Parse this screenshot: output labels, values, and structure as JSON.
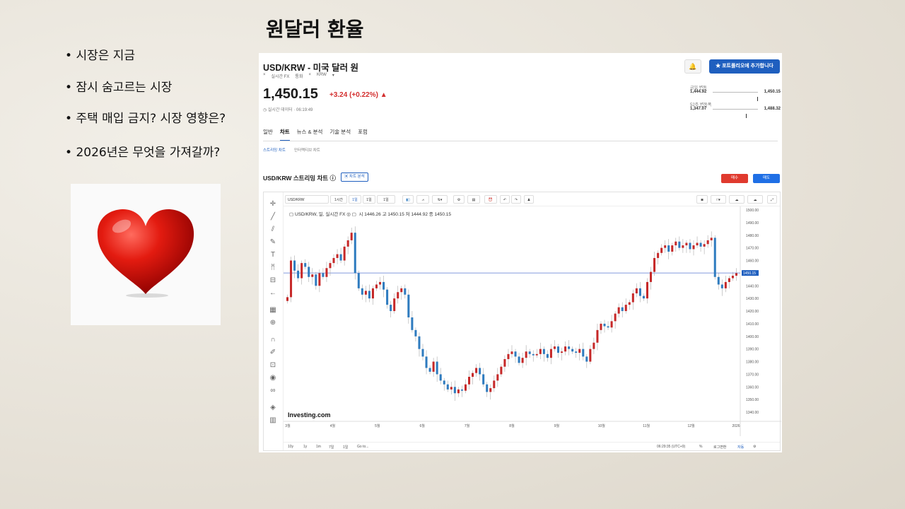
{
  "slide": {
    "title": "원달러 환율",
    "bullets": [
      "시장은 지금",
      "잠시 숨고르는 시장",
      "주택 매입 금지? 시장 영향은?",
      "2026년은 무엇을 가져갈까?"
    ]
  },
  "quote": {
    "pair": "USD/KRW - 미국 달러 원",
    "tags": [
      "×",
      "실시간 FX",
      "통화",
      "×",
      "KRW",
      "▾"
    ],
    "price": "1,450.15",
    "change": "+3.24 (+0.22%) ▲",
    "time": "◷ 실시간 데이터 · 06:19:49",
    "bell": "🔔",
    "portfolio_btn": "★  포트폴리오에 추가합니다",
    "day_range": {
      "label": "금일 변동",
      "low": "1,444.92",
      "high": "1,450.15",
      "pos": 0.98
    },
    "week52_range": {
      "label": "52주 변동폭",
      "low": "1,347.07",
      "high": "1,488.32",
      "pos": 0.73
    }
  },
  "tabs": [
    "일반",
    "차트",
    "뉴스 & 분석",
    "기술 분석",
    "포럼"
  ],
  "active_tab": "차트",
  "subtabs": [
    "스트리밍 차트",
    "인터랙티브 차트"
  ],
  "chart_header": {
    "title": "USD/KRW 스트리밍 차트  ⓘ",
    "analysis_btn": "▣ 차트 분석",
    "sell": "매수",
    "buy": "매도"
  },
  "toolbar": {
    "symbol": "USD/KRW",
    "interval": "1시간",
    "items": [
      "1일",
      "1일",
      "1일"
    ]
  },
  "legend": {
    "text": "▢ USD/KRW, 일, 실시간 FX  ◎ ▢",
    "ohlc": "시 1446.26  고 1450.15  저 1444.92  종 1450.15"
  },
  "bottom": {
    "ranges": [
      "10y",
      "1y",
      "1m",
      "7일",
      "1일",
      "Go to..."
    ],
    "right": [
      "06:29:35 (UTC+9)",
      "%",
      "로그변환",
      "자동",
      "⚙"
    ]
  },
  "watermark": "Investing.com",
  "colors": {
    "up": "#c62828",
    "down": "#2e7bbf",
    "current_line": "#5a78d0",
    "accent": "#1f5fbf"
  },
  "chart_data": {
    "type": "candlestick",
    "ylim": [
      1335,
      1500
    ],
    "current_price": 1450.15,
    "current_price_label": "1450.15",
    "y_ticks": [
      1500,
      1490,
      1480,
      1470,
      1460,
      1450,
      1440,
      1430,
      1420,
      1410,
      1400,
      1390,
      1380,
      1370,
      1360,
      1350,
      1340
    ],
    "x_ticks": [
      "3월",
      "4월",
      "5월",
      "6월",
      "7월",
      "8월",
      "9월",
      "10월",
      "11월",
      "12월",
      "2026"
    ],
    "closes": [
      1431,
      1460,
      1452,
      1446,
      1458,
      1455,
      1447,
      1449,
      1440,
      1450,
      1447,
      1454,
      1458,
      1462,
      1465,
      1460,
      1471,
      1476,
      1482,
      1450,
      1438,
      1433,
      1436,
      1430,
      1438,
      1441,
      1443,
      1437,
      1425,
      1420,
      1430,
      1435,
      1438,
      1433,
      1415,
      1405,
      1400,
      1390,
      1384,
      1375,
      1372,
      1380,
      1370,
      1365,
      1362,
      1358,
      1360,
      1355,
      1358,
      1357,
      1362,
      1368,
      1371,
      1375,
      1370,
      1362,
      1356,
      1359,
      1365,
      1370,
      1376,
      1382,
      1386,
      1388,
      1384,
      1379,
      1383,
      1388,
      1386,
      1385,
      1386,
      1390,
      1386,
      1383,
      1390,
      1392,
      1387,
      1388,
      1392,
      1390,
      1388,
      1387,
      1390,
      1384,
      1380,
      1390,
      1395,
      1405,
      1410,
      1408,
      1407,
      1412,
      1418,
      1423,
      1420,
      1425,
      1427,
      1434,
      1438,
      1432,
      1430,
      1443,
      1451,
      1462,
      1466,
      1470,
      1472,
      1467,
      1472,
      1475,
      1470,
      1472,
      1474,
      1469,
      1472,
      1474,
      1471,
      1473,
      1476,
      1478,
      1447,
      1441,
      1438,
      1443,
      1446,
      1448,
      1450
    ]
  }
}
